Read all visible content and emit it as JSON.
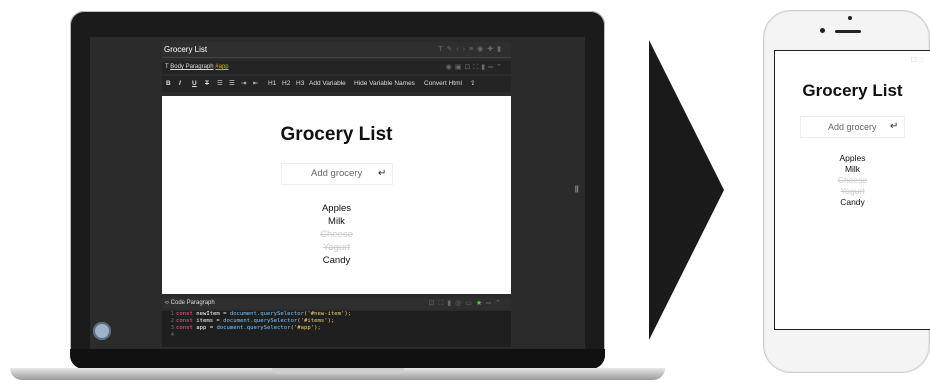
{
  "editor": {
    "title": "Grocery List",
    "paragraph_label": "Body Paragraph",
    "app_tag": "#app",
    "toolbar": {
      "bold": "B",
      "italic": "I",
      "underline": "U",
      "strike": "T",
      "h1": "H1",
      "h2": "H2",
      "h3": "H3",
      "add_variable": "Add Variable",
      "hide_variable_names": "Hide Variable Names",
      "convert_html": "Convert Html"
    },
    "code_label": "Code Paragraph",
    "code_lines": [
      {
        "num": "1",
        "kw": "const",
        "var": "newItem",
        "fn": "document.querySelector",
        "str": "('#new-item');"
      },
      {
        "num": "2",
        "kw": "const",
        "var": "items",
        "fn": "document.querySelector",
        "str": "('#items');"
      },
      {
        "num": "3",
        "kw": "const",
        "var": "app",
        "fn": "document.querySelector",
        "str": "('#app');"
      },
      {
        "num": "4",
        "kw": "",
        "var": "",
        "fn": "",
        "str": ""
      }
    ]
  },
  "app": {
    "heading": "Grocery List",
    "input_placeholder": "Add grocery",
    "items": [
      {
        "text": "Apples",
        "done": false
      },
      {
        "text": "Milk",
        "done": false
      },
      {
        "text": "Cheese",
        "done": true
      },
      {
        "text": "Yogurt",
        "done": true
      },
      {
        "text": "Candy",
        "done": false
      }
    ]
  },
  "icons": {
    "return": "↵",
    "handle": "||"
  },
  "colors": {
    "editor_bg": "#2b2b2b",
    "app_tag": "#e0b000",
    "run_green": "#3ddc3d"
  }
}
